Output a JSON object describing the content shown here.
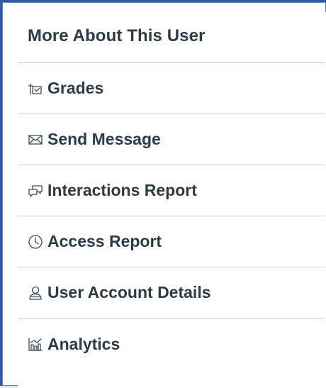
{
  "header": {
    "title": "More About This User"
  },
  "menu": {
    "items": [
      {
        "label": "Grades",
        "icon": "grades-icon"
      },
      {
        "label": "Send Message",
        "icon": "envelope-icon"
      },
      {
        "label": "Interactions Report",
        "icon": "chat-bubbles-icon"
      },
      {
        "label": "Access Report",
        "icon": "clock-icon"
      },
      {
        "label": "User Account Details",
        "icon": "user-icon"
      },
      {
        "label": "Analytics",
        "icon": "analytics-icon"
      }
    ]
  },
  "colors": {
    "text": "#2d3b45",
    "divider": "#c7cdd1",
    "frame_border": "#2f5aa6"
  }
}
